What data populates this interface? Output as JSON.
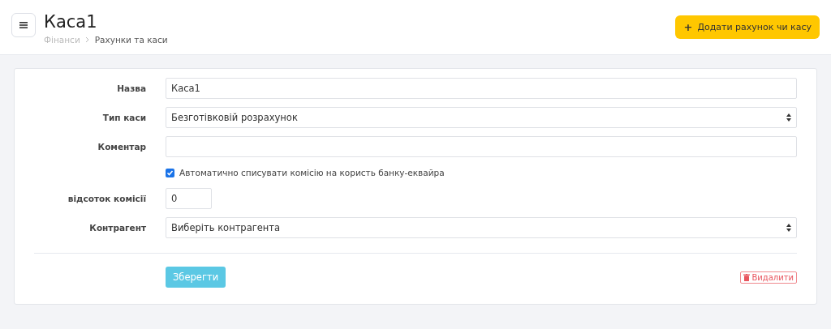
{
  "header": {
    "title": "Каса1",
    "breadcrumbs": [
      {
        "label": "Фінанси",
        "current": false
      },
      {
        "label": "Рахунки та каси",
        "current": true
      }
    ],
    "add_button": {
      "icon": "+",
      "label": "Додати рахунок чи касу"
    }
  },
  "form": {
    "fields": [
      {
        "kind": "text",
        "label": "Назва",
        "value": "Каса1"
      },
      {
        "kind": "select",
        "label": "Тип каси",
        "value": "Безготівковій розрахунок"
      },
      {
        "kind": "text",
        "label": "Коментар"
      },
      {
        "kind": "checkbox",
        "label": "Автоматично списувати комісію на користь банку-еквайра",
        "checked": true
      },
      {
        "kind": "short",
        "label": "відсоток комісії",
        "value": "0"
      },
      {
        "kind": "select",
        "label": "Контрагент",
        "value": "Виберіть контрагента"
      }
    ],
    "save_button": "Зберегти",
    "delete_button": "Видалити"
  }
}
